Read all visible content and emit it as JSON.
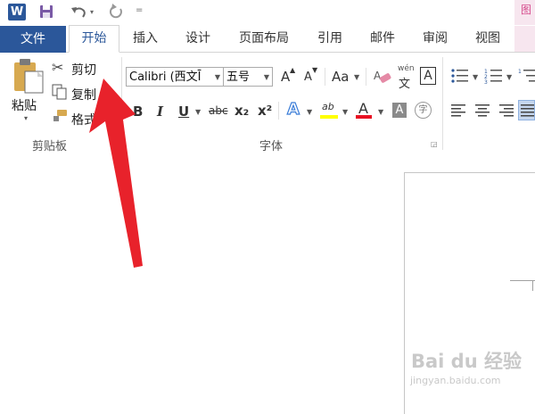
{
  "app": {
    "logo_letter": "W",
    "qat_more": "="
  },
  "pink_label": "图",
  "tabs": {
    "file": "文件",
    "items": [
      "开始",
      "插入",
      "设计",
      "页面布局",
      "引用",
      "邮件",
      "审阅",
      "视图"
    ]
  },
  "clipboard": {
    "paste": "粘贴",
    "cut": "剪切",
    "copy": "复制",
    "format_painter": "格式",
    "group_label": "剪贴板"
  },
  "font": {
    "font_name": "Calibri (西文Ī",
    "font_size": "五号",
    "group_label": "字体",
    "grow": "A",
    "shrink": "A",
    "case": "Aa",
    "phonetic_top": "wén",
    "phonetic_bottom": "文",
    "border_char": "A",
    "bold": "B",
    "italic": "I",
    "underline": "U",
    "strike": "abc",
    "subscript": "x₂",
    "superscript": "x²",
    "text_effect": "A",
    "highlight": "ab",
    "font_color": "A",
    "shading": "A",
    "enclose": "字"
  },
  "colors": {
    "accent": "#2b579a",
    "arrow": "#e8222b",
    "highlight": "#ffff00",
    "font_color": "#e81123"
  },
  "watermark": {
    "brand": "Bai du 经验",
    "url": "jingyan.baidu.com"
  }
}
